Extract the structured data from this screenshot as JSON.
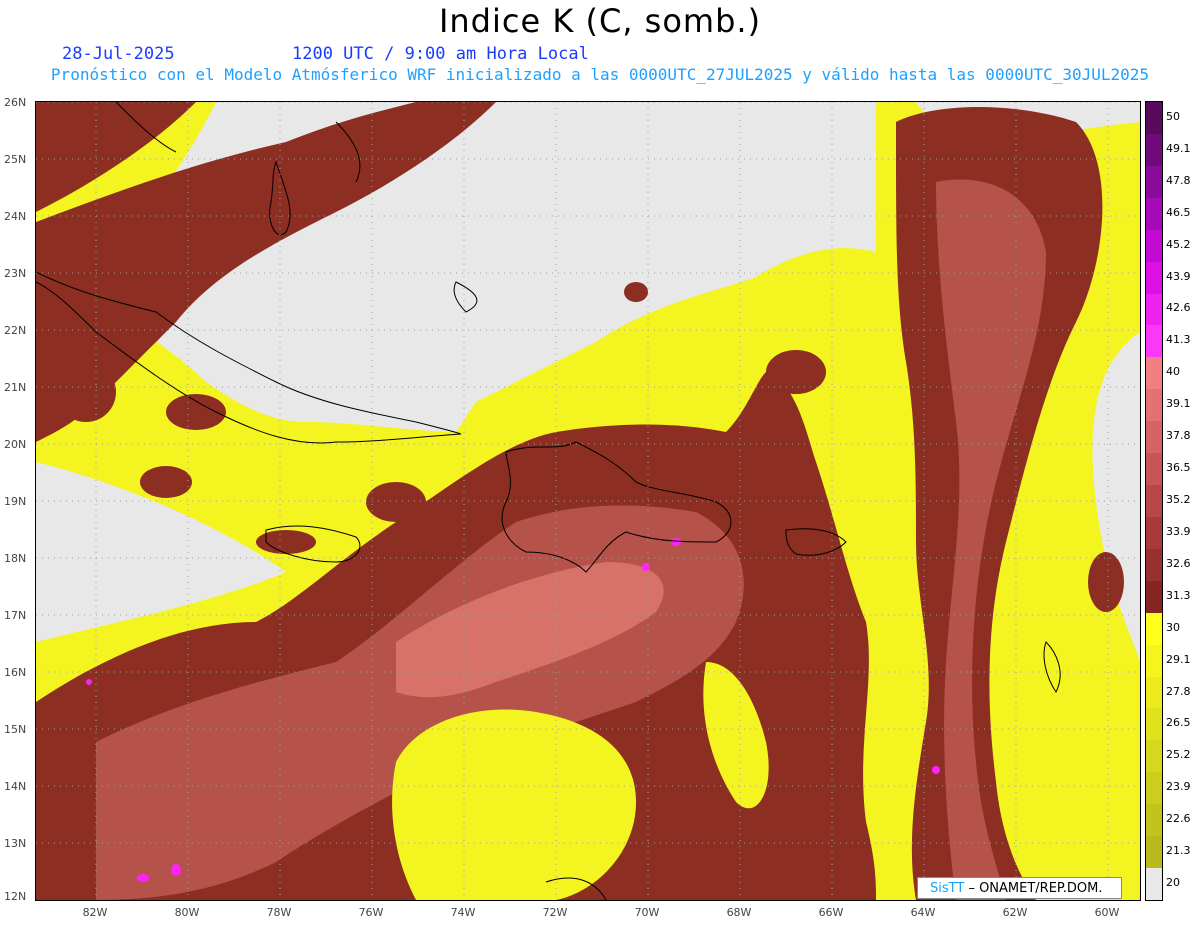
{
  "title": "Indice K (C, somb.)",
  "date": "28-Jul-2025",
  "time_label": "1200 UTC / 9:00 am Hora Local",
  "description": "Pronóstico con el Modelo Atmósferico WRF inicializado a las 0000UTC_27JUL2025 y válido hasta las  0000UTC_30JUL2025",
  "lat_labels": [
    "26N",
    "25N",
    "24N",
    "23N",
    "22N",
    "21N",
    "20N",
    "19N",
    "18N",
    "17N",
    "16N",
    "15N",
    "14N",
    "13N",
    "12N"
  ],
  "lon_labels": [
    "82W",
    "80W",
    "78W",
    "76W",
    "74W",
    "72W",
    "70W",
    "68W",
    "66W",
    "64W",
    "62W",
    "60W"
  ],
  "colorbar": {
    "labels": [
      "50",
      "49.1",
      "47.8",
      "46.5",
      "45.2",
      "43.9",
      "42.6",
      "41.3",
      "40",
      "39.1",
      "37.8",
      "36.5",
      "35.2",
      "33.9",
      "32.6",
      "31.3",
      "30",
      "29.1",
      "27.8",
      "26.5",
      "25.2",
      "23.9",
      "22.6",
      "21.3",
      "20"
    ],
    "colors": [
      "#5a0a5a",
      "#6e0a7a",
      "#8a0a9a",
      "#a60ab6",
      "#c20ad2",
      "#dc10e4",
      "#ee22ee",
      "#fa38fa",
      "#f28080",
      "#e47272",
      "#d66464",
      "#c85656",
      "#b84848",
      "#a83a3a",
      "#973030",
      "#862424",
      "#ffff1e",
      "#f5f51e",
      "#ebeb1e",
      "#e1e11e",
      "#d7d71e",
      "#cdcd1e",
      "#c3c31e",
      "#b9b91e",
      "#e8e8e8"
    ]
  },
  "credit": {
    "brand": "SisTT",
    "text": "– ONAMET/REP.DOM."
  },
  "legend_colors": {
    "no_data": "#e8e8e8",
    "yellow": "#f4f420",
    "brown": "#8c2e22",
    "mid": "#b5524a",
    "light": "#d67268",
    "magenta": "#ff22ff"
  }
}
